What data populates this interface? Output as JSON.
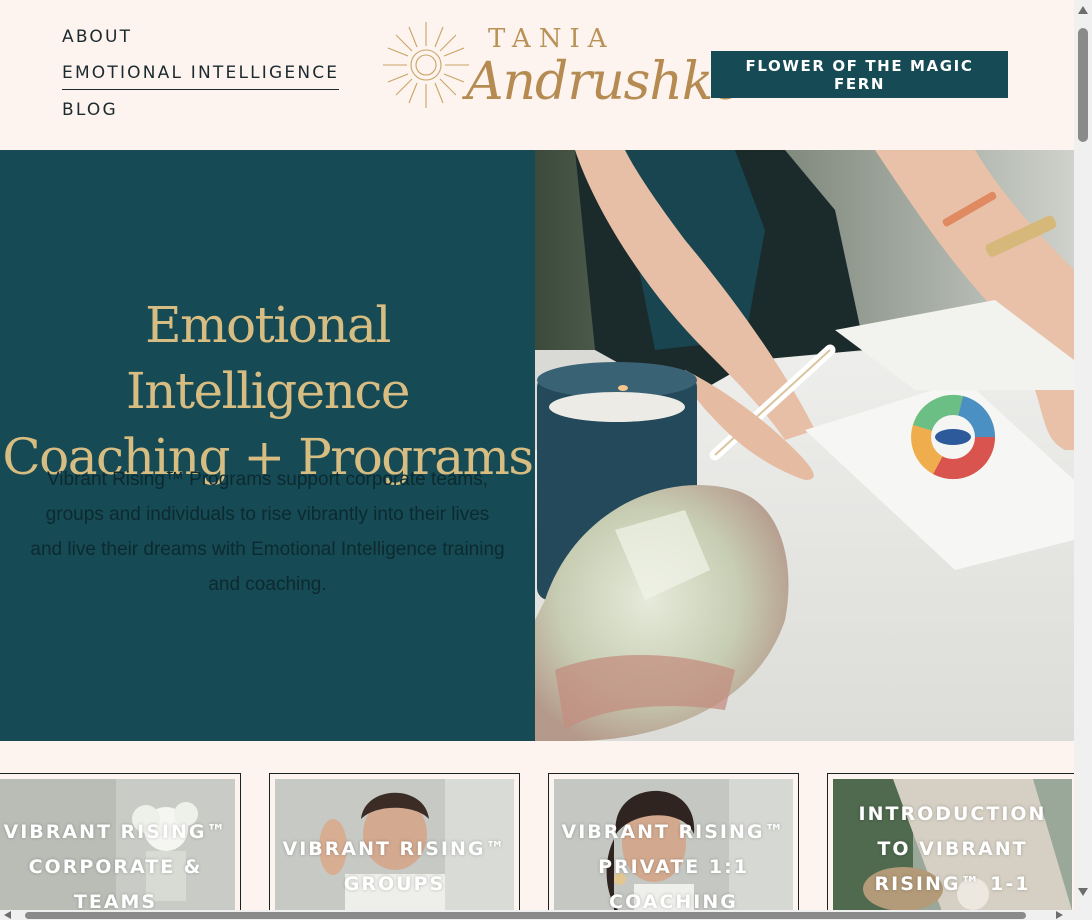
{
  "nav": {
    "items": [
      {
        "label": "ABOUT"
      },
      {
        "label": "EMOTIONAL INTELLIGENCE"
      },
      {
        "label": "BLOG"
      }
    ]
  },
  "logo": {
    "line1": "TANIA",
    "line2": "Andrushko"
  },
  "header": {
    "cta_label": "FLOWER OF THE MAGIC FERN"
  },
  "hero": {
    "title_line1": "Emotional Intelligence",
    "title_line2": "Coaching + Programs",
    "text_line1": "Vibrant Rising™ Programs support corporate teams,",
    "text_line2": "groups and individuals to rise vibrantly into their lives",
    "text_line3": "and live their dreams with Emotional Intelligence training",
    "text_line4": "and coaching."
  },
  "cards": [
    {
      "line1": "VIBRANT RISING™",
      "line2": "CORPORATE &",
      "line3": "TEAMS"
    },
    {
      "line1": "VIBRANT RISING™",
      "line2": "GROUPS"
    },
    {
      "line1": "VIBRANT RISING™",
      "line2": "PRIVATE 1:1",
      "line3": "COACHING"
    },
    {
      "line1": "INTRODUCTION",
      "line2": "TO VIBRANT",
      "line3": "RISING™ 1-1"
    }
  ],
  "colors": {
    "background": "#fdf3ef",
    "teal": "#164a55",
    "gold": "#d8bd82",
    "text_dark": "#1c2a2f"
  },
  "icons": {
    "logo_mark": "sunburst-icon",
    "scroll_up": "arrow-up-icon",
    "scroll_down": "arrow-down-icon",
    "scroll_left": "arrow-left-icon",
    "scroll_right": "arrow-right-icon"
  }
}
